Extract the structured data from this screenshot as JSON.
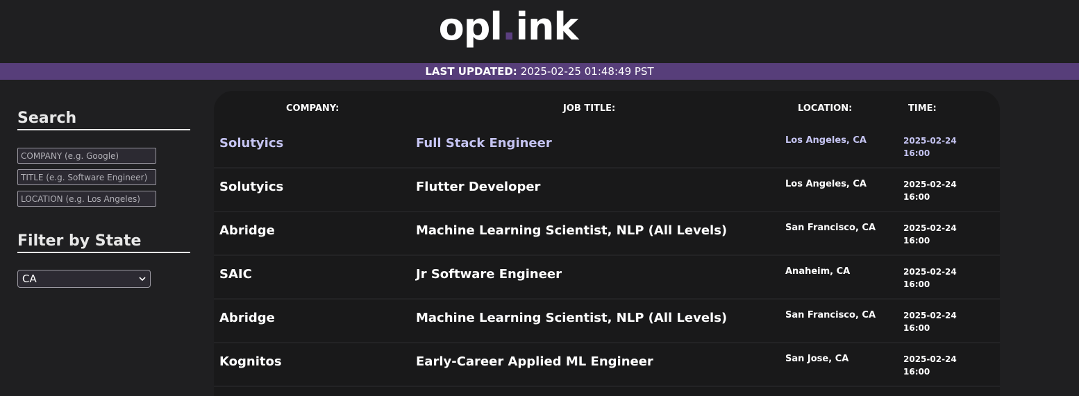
{
  "header": {
    "logo_left": "opl",
    "logo_dot": ".",
    "logo_right": "ink"
  },
  "banner": {
    "label": "LAST UPDATED:",
    "value": "2025-02-25 01:48:49 PST"
  },
  "sidebar": {
    "search_heading": "Search",
    "company_placeholder": "COMPANY (e.g. Google)",
    "title_placeholder": "TITLE (e.g. Software Engineer)",
    "location_placeholder": "LOCATION (e.g. Los Angeles)",
    "filter_heading": "Filter by State",
    "state_selected": "CA"
  },
  "table": {
    "headers": {
      "company": "COMPANY:",
      "title": "JOB TITLE:",
      "location": "LOCATION:",
      "time": "TIME:"
    },
    "rows": [
      {
        "company": "Solutyics",
        "title": "Full Stack Engineer",
        "location": "Los Angeles, CA",
        "time": "2025-02-24 16:00"
      },
      {
        "company": "Solutyics",
        "title": "Flutter Developer",
        "location": "Los Angeles, CA",
        "time": "2025-02-24 16:00"
      },
      {
        "company": "Abridge",
        "title": "Machine Learning Scientist, NLP (All Levels)",
        "location": "San Francisco, CA",
        "time": "2025-02-24 16:00"
      },
      {
        "company": "SAIC",
        "title": "Jr Software Engineer",
        "location": "Anaheim, CA",
        "time": "2025-02-24 16:00"
      },
      {
        "company": "Abridge",
        "title": "Machine Learning Scientist, NLP (All Levels)",
        "location": "San Francisco, CA",
        "time": "2025-02-24 16:00"
      },
      {
        "company": "Kognitos",
        "title": "Early-Career Applied ML Engineer",
        "location": "San Jose, CA",
        "time": "2025-02-24 16:00"
      }
    ]
  },
  "colors": {
    "background": "#1f1f21",
    "accent": "#573e7a",
    "highlight_text": "#c5c4f2"
  },
  "icons": {
    "select_arrow": "chevron-down-icon"
  }
}
